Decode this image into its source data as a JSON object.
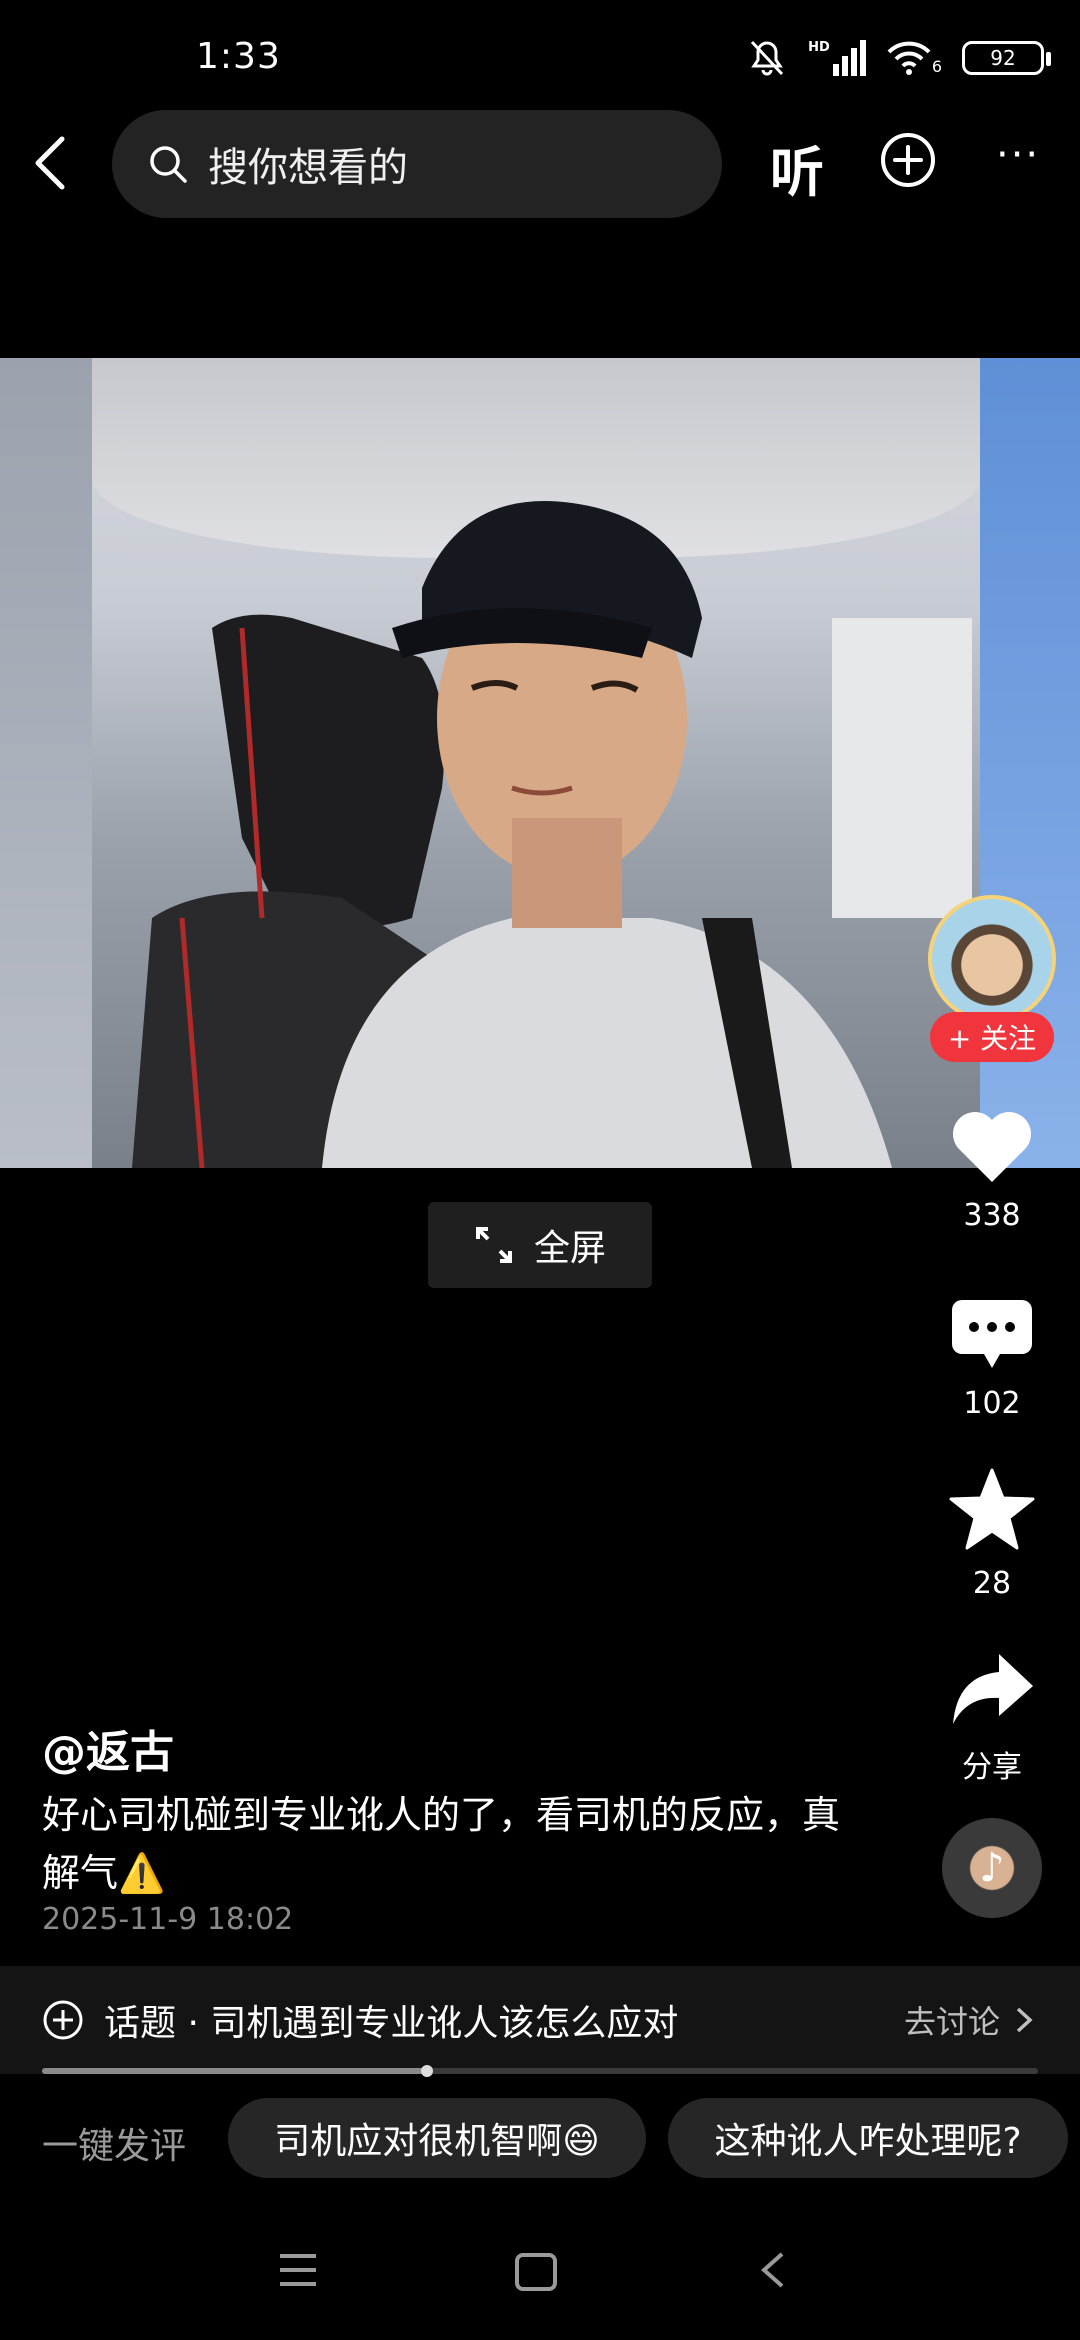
{
  "status_bar": {
    "time": "1:33",
    "hd": "HD",
    "wifi_label": "6",
    "battery": "92"
  },
  "top_nav": {
    "search_placeholder": "搜你想看的",
    "listen_label": "听",
    "more_label": "···"
  },
  "video": {
    "fullscreen_label": "全屏"
  },
  "side_actions": {
    "follow_label": "+ 关注",
    "likes": "338",
    "comments": "102",
    "favorites": "28",
    "share_label": "分享"
  },
  "post": {
    "author": "@返古",
    "caption": "好心司机碰到专业讹人的了，看司机的反应，真解气⚠️",
    "date": "2025-11-9 18:02"
  },
  "topic": {
    "label": "话题 · 司机遇到专业讹人该怎么应对",
    "action": "去讨论",
    "progress": 0.387
  },
  "quick_comment": {
    "label": "一键发评",
    "chips": [
      "司机应对很机智啊😄",
      "这种讹人咋处理呢?"
    ]
  }
}
